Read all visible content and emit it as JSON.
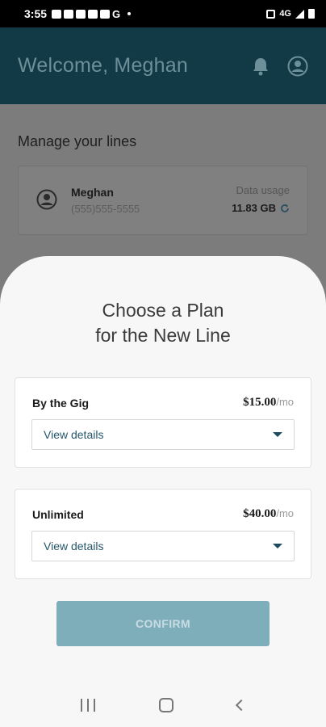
{
  "status_bar": {
    "time": "3:55",
    "g_label": "G",
    "network": "4G"
  },
  "header": {
    "welcome": "Welcome, Meghan",
    "icons": [
      "bell-icon",
      "account-icon"
    ]
  },
  "lines": {
    "title": "Manage your lines",
    "card": {
      "name": "Meghan",
      "phone": "(555)555-5555",
      "usage_label": "Data usage",
      "usage_value": "11.83 GB"
    }
  },
  "sheet": {
    "title_line1": "Choose a Plan",
    "title_line2": "for the New Line",
    "plans": [
      {
        "name": "By the Gig",
        "price": "$15.00",
        "period": "/mo",
        "details_label": "View details"
      },
      {
        "name": "Unlimited",
        "price": "$40.00",
        "period": "/mo",
        "details_label": "View details"
      }
    ],
    "confirm_label": "CONFIRM"
  },
  "colors": {
    "header_bg": "#123a46",
    "accent": "#24566a",
    "confirm_disabled": "#7faebb"
  }
}
